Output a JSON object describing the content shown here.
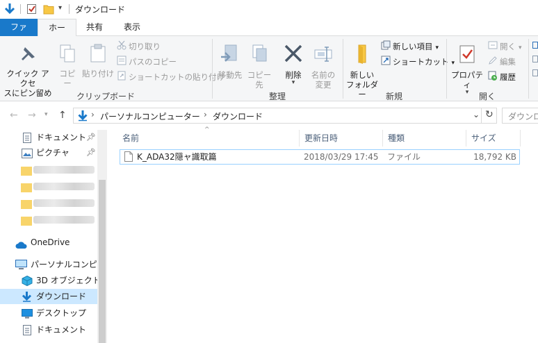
{
  "window": {
    "title": "ダウンロード"
  },
  "ribbon_tabs": {
    "file": "ファイル",
    "home": "ホーム",
    "share": "共有",
    "view": "表示"
  },
  "clipboard": {
    "pin_quick_access_line1": "クイック アクセ",
    "pin_quick_access_line2": "スにピン留め",
    "copy": "コピー",
    "paste": "貼り付け",
    "cut": "切り取り",
    "copy_path": "パスのコピー",
    "paste_shortcut": "ショートカットの貼り付け",
    "group_label": "クリップボード"
  },
  "organize": {
    "move_to": "移動先",
    "copy_to": "コピー先",
    "delete": "削除",
    "rename_line1": "名前の",
    "rename_line2": "変更",
    "group_label": "整理"
  },
  "new": {
    "new_folder_line1": "新しい",
    "new_folder_line2": "フォルダー",
    "new_item": "新しい項目",
    "easy_access": "ショートカット",
    "group_label": "新規"
  },
  "open": {
    "properties": "プロパティ",
    "open": "開く",
    "edit": "編集",
    "history": "履歴",
    "group_label": "開く"
  },
  "address": {
    "crumbs": [
      "パーソナルコンピューター",
      "ダウンロード"
    ],
    "search_placeholder": "ダウンロー"
  },
  "nav": {
    "items": [
      {
        "label": "ドキュメント",
        "pinned": true
      },
      {
        "label": "ピクチャ",
        "pinned": true
      },
      {
        "label": "OneDrive"
      },
      {
        "label": "パーソナルコンピュータ"
      },
      {
        "label": "3D オブジェクト"
      },
      {
        "label": "ダウンロード"
      },
      {
        "label": "デスクトップ"
      },
      {
        "label": "ドキュメント"
      }
    ]
  },
  "columns": {
    "name": "名前",
    "date": "更新日時",
    "type": "種類",
    "size": "サイズ"
  },
  "files": [
    {
      "name": "K_ADA32隠ャ識取篇",
      "date": "2018/03/29 17:45",
      "type": "ファイル",
      "size": "18,792 KB"
    }
  ],
  "colors": {
    "accent": "#1979ca",
    "selection": "#cce8ff",
    "folder": "#f8c845"
  }
}
